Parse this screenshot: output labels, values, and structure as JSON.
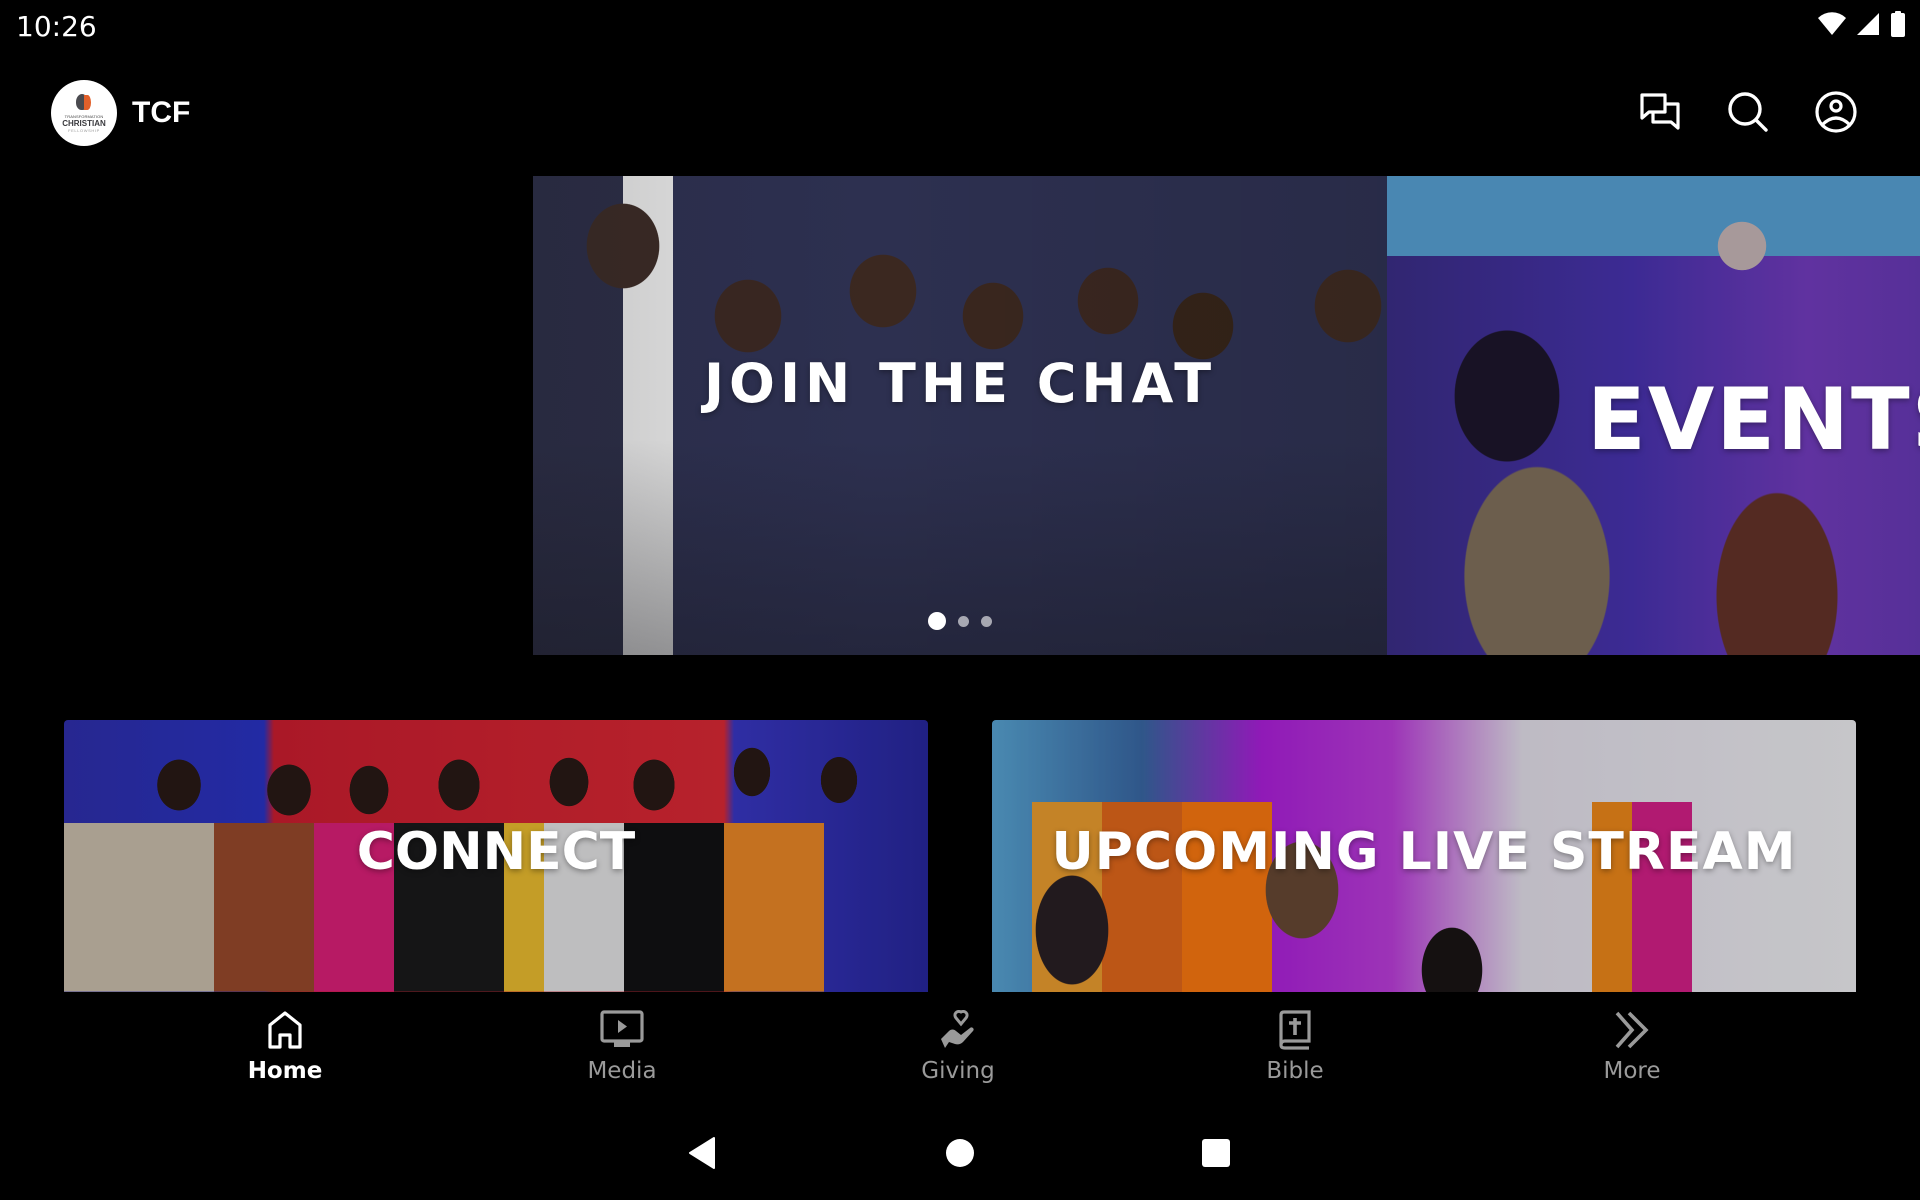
{
  "status_bar": {
    "time": "10:26",
    "icons": [
      "wifi-icon",
      "cell-signal-icon",
      "battery-icon"
    ]
  },
  "header": {
    "logo": {
      "line1": "TRANSFORMATION",
      "line2": "CHRISTIAN",
      "line3": "FELLOWSHIP"
    },
    "title": "TCF",
    "actions": [
      {
        "name": "chat",
        "icon": "chat-bubbles-icon"
      },
      {
        "name": "search",
        "icon": "search-icon"
      },
      {
        "name": "profile",
        "icon": "account-circle-icon"
      }
    ]
  },
  "carousel": {
    "slides": [
      {
        "title": "JOIN THE CHAT"
      },
      {
        "title": "EVENTS"
      }
    ],
    "visible_title_2": "EVENT",
    "page_count": 3,
    "active_index": 0
  },
  "cards": [
    {
      "title": "CONNECT"
    },
    {
      "title": "UPCOMING LIVE STREAM"
    }
  ],
  "bottom_nav": {
    "items": [
      {
        "label": "Home",
        "icon": "home-icon",
        "active": true
      },
      {
        "label": "Media",
        "icon": "media-play-icon",
        "active": false
      },
      {
        "label": "Giving",
        "icon": "giving-hand-heart-icon",
        "active": false
      },
      {
        "label": "Bible",
        "icon": "bible-icon",
        "active": false
      },
      {
        "label": "More",
        "icon": "double-chevron-right-icon",
        "active": false
      }
    ],
    "active_color": "#ffffff",
    "inactive_color": "#9a9a9a"
  },
  "system_nav": {
    "buttons": [
      "back",
      "home",
      "recents"
    ]
  }
}
